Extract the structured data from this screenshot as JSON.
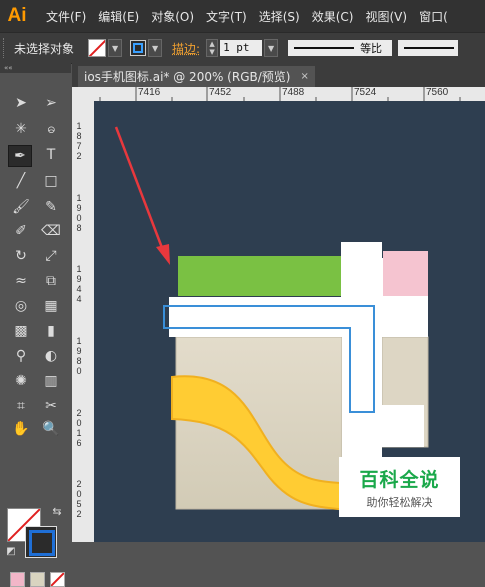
{
  "app": {
    "logo": "Ai"
  },
  "menu": [
    "文件(F)",
    "编辑(E)",
    "对象(O)",
    "文字(T)",
    "选择(S)",
    "效果(C)",
    "视图(V)",
    "窗口("
  ],
  "control_bar": {
    "selection_label": "未选择对象",
    "stroke_label": "描边:",
    "stroke_weight": "1 pt",
    "profile_label": "等比"
  },
  "document": {
    "tab_title": "ios手机图标.ai* @ 200% (RGB/预览)",
    "close_glyph": "×"
  },
  "rulers": {
    "horizontal": [
      "7416",
      "7452",
      "7488",
      "7524",
      "7560"
    ],
    "vertical": [
      "1872",
      "1908",
      "1944",
      "1980",
      "2016",
      "2052"
    ]
  },
  "toolbox": {
    "header": "««"
  },
  "watermark": {
    "title": "百科全说",
    "subtitle": "助你轻松解决"
  },
  "colors": {
    "canvas_bg": "#2e3e50",
    "green": "#7ac143",
    "pink": "#f5c4d0",
    "beige": "#ddd6c4",
    "yellow": "#ffcc33",
    "blue_outline": "#3a8fd8",
    "arrow": "#e8383d"
  }
}
